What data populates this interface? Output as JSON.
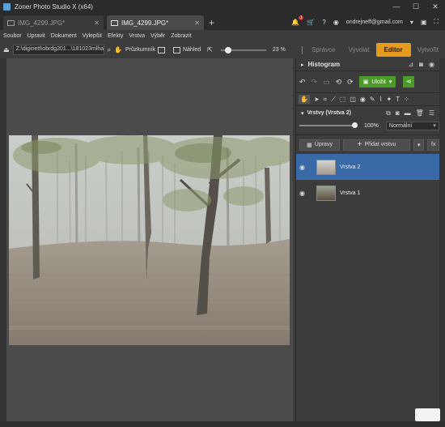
{
  "window": {
    "title": "Zoner Photo Studio X (x64)",
    "controls": [
      "—",
      "☐",
      "✕"
    ]
  },
  "tabs": [
    {
      "label": "IMG_4299.JPG*",
      "close": "✕",
      "active": false
    },
    {
      "label": "IMG_4299.JPG*",
      "close": "✕",
      "active": true
    }
  ],
  "tab_add": "+",
  "topbar": {
    "notifications_icon": "bell-icon",
    "notifications_count": "1",
    "cart_icon": "cart-icon",
    "help": "?",
    "account": "ondrejneff@gmail.com",
    "account_caret": "▾"
  },
  "menu": [
    "Soubor",
    "Upravit",
    "Dokument",
    "Vylepšit",
    "Efekty",
    "Vrstva",
    "Výběr",
    "Zobrazit"
  ],
  "modules": {
    "items": [
      {
        "label": "Správce",
        "active": false
      },
      {
        "label": "Vyvolat",
        "active": false
      },
      {
        "label": "Editor",
        "active": true
      },
      {
        "label": "Vytvořit",
        "active": false
      }
    ],
    "accent_color": "#e49b1e"
  },
  "address": {
    "path": "Z:\\diginett\\obrdg201...\\181023mlha",
    "explore_label": "Průzkumník",
    "preview_label": "Náhled",
    "zoom": "23 %",
    "zoom_level": 0.1
  },
  "panel": {
    "histogram_title": "Histogram",
    "save_label": "Uložit",
    "save_color": "#4c9a2a",
    "layers_title": "Vrstvy (Vrstva 2)",
    "opacity": "100%",
    "opacity_level": 1.0,
    "blend_mode": "Normální",
    "adjustments_label": "Úpravy",
    "add_layer_label": "Přidat vrstvu",
    "fx_label": "fx",
    "layers": [
      {
        "name": "Vrstva 2",
        "selected": true
      },
      {
        "name": "Vrstva 1",
        "selected": false
      }
    ],
    "selected_color": "#3a69a8"
  }
}
